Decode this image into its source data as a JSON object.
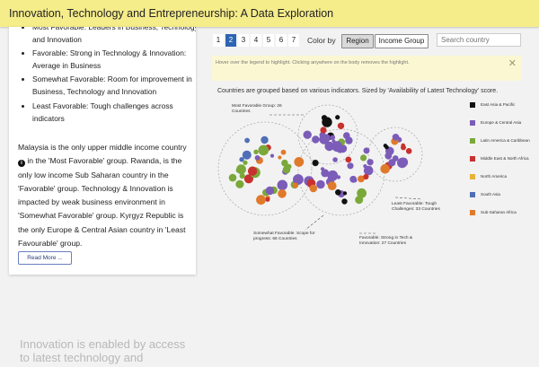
{
  "header": {
    "title": "Innovation, Technology and Entrepreneurship: A Data Exploration"
  },
  "left_panel": {
    "bullets": [
      "Most Favorable: Leaders in Business, Technology and Innovation",
      "Favorable: Strong in Technology & Innovation: Average in Business",
      "Somewhat Favorable: Room for improvement in Business, Technology and Innovation",
      "Least Favorable: Tough challenges across indicators"
    ],
    "para_part1": "Malaysia is the only upper middle income country",
    "para_part2": "in the 'Most Favorable' group. Rwanda, is the only low income Sub Saharan country in the 'Favorable' group. Technology & Innovation is impacted by weak business environment in 'Somewhat Favorable' group. Kyrgyz Republic is the only Europe & Central Asian country in 'Least Favourable' group.",
    "read_more": "Read More ...",
    "faded_text": "Innovation is enabled by access to latest technology and"
  },
  "controls": {
    "pages": [
      "1",
      "2",
      "3",
      "4",
      "5",
      "6",
      "7"
    ],
    "active_page": "2",
    "color_by_label": "Color by",
    "region_button": "Region",
    "income_button": "Income Group",
    "search_placeholder": "Search country"
  },
  "hint": {
    "text": "Hover over the legend to highlight. Clicking anywhere on the body removes the highlight.",
    "close": "✕"
  },
  "chart": {
    "subtitle": "Countries are grouped based on various indicators. Sized by 'Availability of Latest Technology' score.",
    "legend": [
      {
        "label": "East Asia & Pacific",
        "color": "#111111"
      },
      {
        "label": "Europe & Central Asia",
        "color": "#7b5cb8"
      },
      {
        "label": "Latin America & Caribbean",
        "color": "#7ba83a"
      },
      {
        "label": "Middle East & North Africa",
        "color": "#c8312f"
      },
      {
        "label": "North America",
        "color": "#e8b23a"
      },
      {
        "label": "South Asia",
        "color": "#4f6fb8"
      },
      {
        "label": "Sub-Saharan Africa",
        "color": "#e07a2b"
      }
    ],
    "annotations": {
      "most": "Most Favorable Group: 26 Countries",
      "least": "Least Favorable: Tough Challenges: 33 Countries",
      "somewhat": "Somewhat Favorable: Scope for progress: 66 Countries",
      "favorable": "Favorable: Strong in Tech & Innovation: 27 Countries"
    }
  }
}
